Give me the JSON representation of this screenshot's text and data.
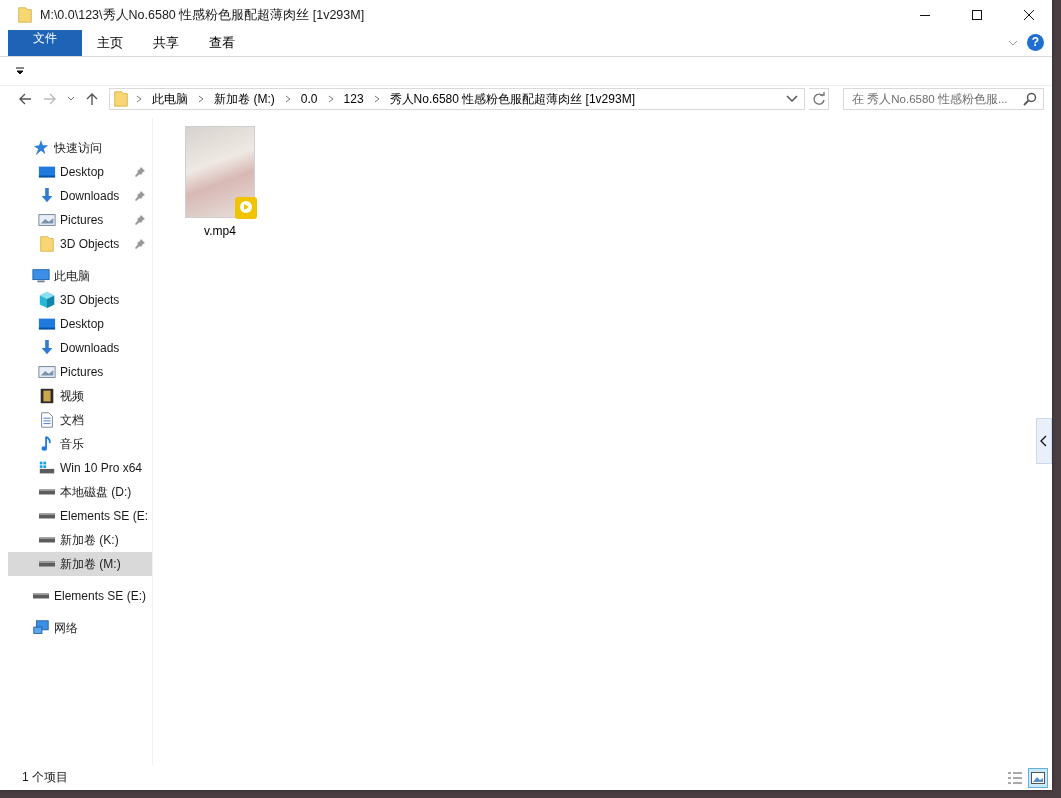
{
  "window": {
    "title": "M:\\0.0\\123\\秀人No.6580 性感粉色服配超薄肉丝 [1v293M]"
  },
  "ribbon": {
    "tabs": [
      {
        "label": "文件",
        "kind": "file"
      },
      {
        "label": "主页",
        "kind": "tab"
      },
      {
        "label": "共享",
        "kind": "tab"
      },
      {
        "label": "查看",
        "kind": "tab"
      }
    ],
    "help": "?"
  },
  "address_bar": {
    "segments": [
      "此电脑",
      "新加卷 (M:)",
      "0.0",
      "123",
      "秀人No.6580 性感粉色服配超薄肉丝 [1v293M]"
    ]
  },
  "search": {
    "placeholder": "在 秀人No.6580 性感粉色服..."
  },
  "navigation": [
    {
      "label": "快速访问",
      "kind": "star",
      "selected": false,
      "children": [
        {
          "label": "Desktop",
          "kind": "desktop",
          "pinned": true,
          "selected": false
        },
        {
          "label": "Downloads",
          "kind": "download",
          "pinned": true,
          "selected": false
        },
        {
          "label": "Pictures",
          "kind": "pictures",
          "pinned": true,
          "selected": false
        },
        {
          "label": "3D Objects",
          "kind": "folder",
          "pinned": true,
          "selected": false
        }
      ]
    },
    {
      "label": "此电脑",
      "kind": "pc",
      "selected": false,
      "children": [
        {
          "label": "3D Objects",
          "kind": "cube",
          "pinned": false,
          "selected": false
        },
        {
          "label": "Desktop",
          "kind": "desktop",
          "pinned": false,
          "selected": false
        },
        {
          "label": "Downloads",
          "kind": "download",
          "pinned": false,
          "selected": false
        },
        {
          "label": "Pictures",
          "kind": "pictures",
          "pinned": false,
          "selected": false
        },
        {
          "label": "视频",
          "kind": "video",
          "pinned": false,
          "selected": false
        },
        {
          "label": "文档",
          "kind": "document",
          "pinned": false,
          "selected": false
        },
        {
          "label": "音乐",
          "kind": "music",
          "pinned": false,
          "selected": false
        },
        {
          "label": "Win 10 Pro x64",
          "kind": "osdrive",
          "pinned": false,
          "selected": false
        },
        {
          "label": "本地磁盘 (D:)",
          "kind": "drive",
          "pinned": false,
          "selected": false
        },
        {
          "label": "Elements SE (E:",
          "kind": "drive",
          "pinned": false,
          "selected": false
        },
        {
          "label": "新加卷 (K:)",
          "kind": "drive",
          "pinned": false,
          "selected": false
        },
        {
          "label": "新加卷 (M:)",
          "kind": "drive",
          "pinned": false,
          "selected": true
        }
      ]
    },
    {
      "label": "Elements SE (E:)",
      "kind": "drive",
      "selected": false
    },
    {
      "label": "网络",
      "kind": "network",
      "selected": false
    }
  ],
  "files": [
    {
      "name": "v.mp4",
      "kind": "video"
    }
  ],
  "status_bar": {
    "text": "1 个项目",
    "views": [
      {
        "kind": "details",
        "selected": false
      },
      {
        "kind": "thumbnails",
        "selected": true
      }
    ]
  }
}
